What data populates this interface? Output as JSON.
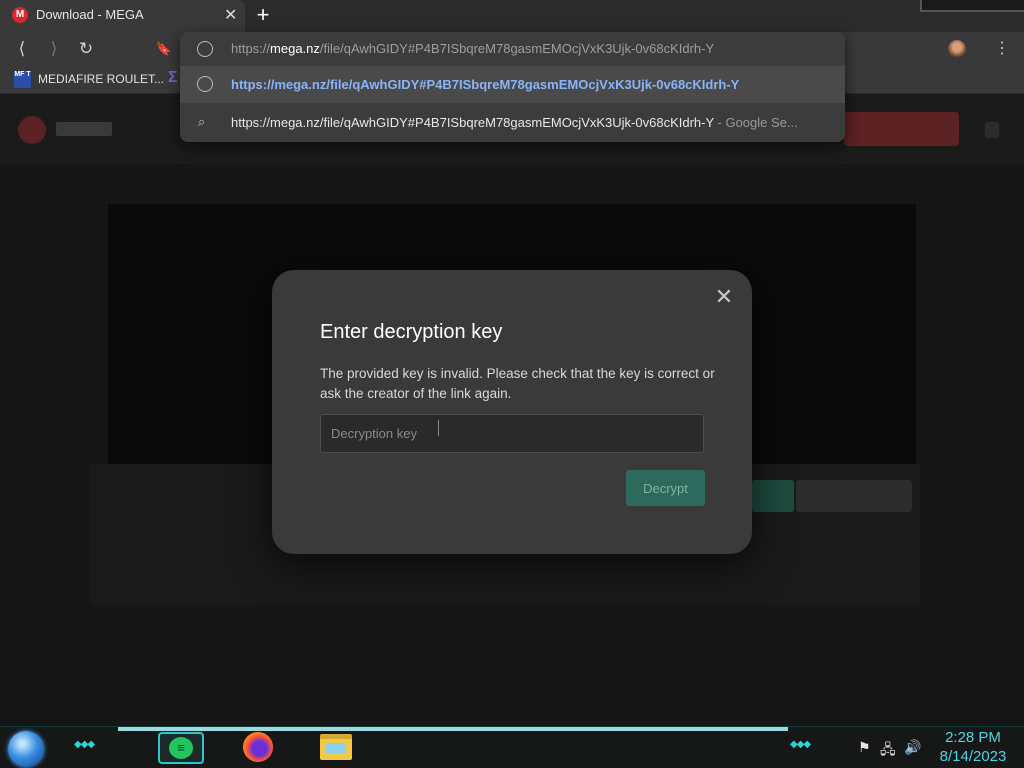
{
  "browser": {
    "tab": {
      "favicon_letter": "M",
      "title": "Download - MEGA",
      "close_glyph": "✕"
    },
    "new_tab_glyph": "+",
    "nav": {
      "back": "⟨",
      "forward": "⟩",
      "reload": "↻",
      "bookmark": "🔖"
    },
    "omnibox": {
      "url_prefix": "https://",
      "url_host": "mega.nz",
      "url_rest": "/file/qAwhGIDY#P4B7ISbqreM78gasmEMOcjVxK3Ujk-0v68cKIdrh-Y",
      "suggestions": [
        {
          "text": "https://mega.nz/file/qAwhGIDY#P4B7ISbqreM78gasmEMOcjVxK3Ujk-0v68cKIdrh-Y",
          "icon": "globe-icon"
        },
        {
          "text": "https://mega.nz/file/qAwhGIDY#P4B7ISbqreM78gasmEMOcjVxK3Ujk-0v68cKIdrh-Y",
          "suffix": " - Google Se...",
          "icon": "search-icon"
        }
      ]
    },
    "menu_glyph": "⋮",
    "bookmarks": [
      {
        "icon_text": "MF T",
        "label": "MEDIAFIRE ROULET..."
      }
    ],
    "bookmark_sigma": "Σ"
  },
  "dialog": {
    "close_glyph": "✕",
    "title": "Enter decryption key",
    "message": "The provided key is invalid. Please check that the key is correct or ask the creator of the link again.",
    "input_placeholder": "Decryption key",
    "input_value": "",
    "button_label": "Decrypt"
  },
  "taskbar": {
    "deco_glyphs": "◆◆◆",
    "app_icon": "≡",
    "tray": {
      "flag": "⚑",
      "network": "🖧",
      "volume": "🔊"
    },
    "clock": {
      "time": "2:28 PM",
      "date": "8/14/2023"
    }
  },
  "colors": {
    "dialog_bg": "#3a3a3a",
    "decrypt_button": "#2e6a5c",
    "suggestion_link": "#8ab4f8",
    "clock": "#4fd4e0",
    "mega_red": "#d9272e"
  }
}
